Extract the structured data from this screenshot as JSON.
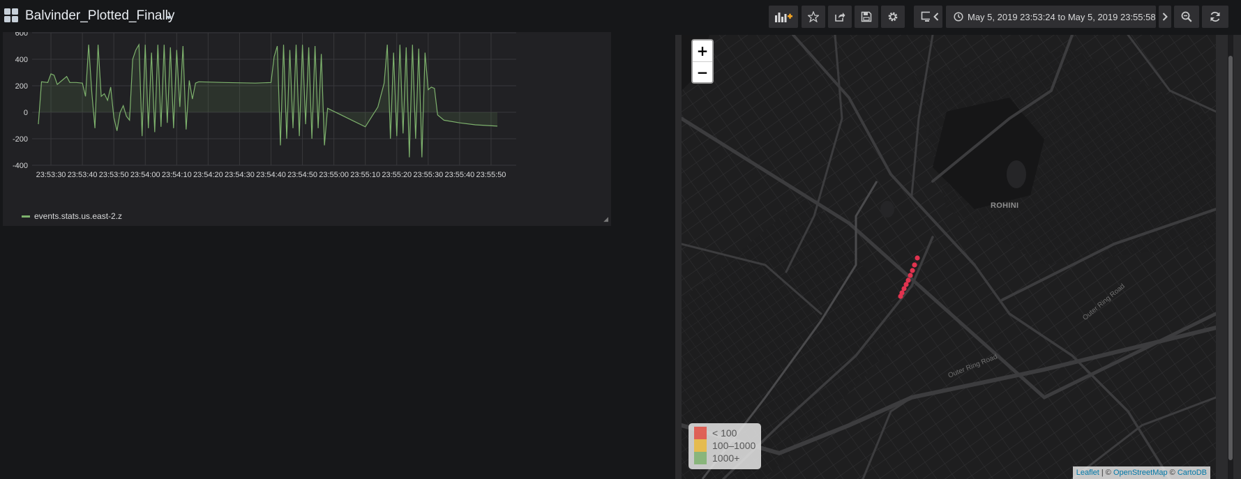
{
  "navbar": {
    "title": "Balvinder_Plotted_Finally",
    "buttons": [
      "add-panel-icon",
      "star-icon",
      "share-icon",
      "save-icon",
      "gear-icon",
      "monitor-icon"
    ],
    "time_range": "May 5, 2019 23:53:24 to May 5, 2019 23:55:58"
  },
  "graph": {
    "legend_label": "events.stats.us.east-2.z",
    "series_color": "#7eb26d",
    "y_ticks": [
      "600",
      "400",
      "200",
      "0",
      "-200",
      "-400"
    ],
    "x_ticks": [
      "23:53:30",
      "23:53:40",
      "23:53:50",
      "23:54:00",
      "23:54:10",
      "23:54:20",
      "23:54:30",
      "23:54:40",
      "23:54:50",
      "23:55:00",
      "23:55:10",
      "23:55:20",
      "23:55:30",
      "23:55:40",
      "23:55:50"
    ]
  },
  "chart_data": {
    "type": "area",
    "title": "",
    "xlabel": "",
    "ylabel": "",
    "ylim": [
      -400,
      600
    ],
    "grid": true,
    "legend": "bottom-left",
    "series": [
      {
        "name": "events.stats.us.east-2.z",
        "color": "#7eb26d",
        "x_seconds_offsets_note_hidden": null,
        "points": [
          [
            "23:53:26",
            -90
          ],
          [
            "23:53:27",
            230
          ],
          [
            "23:53:29",
            225
          ],
          [
            "23:53:30",
            290
          ],
          [
            "23:53:31",
            280
          ],
          [
            "23:53:32",
            210
          ],
          [
            "23:53:34",
            250
          ],
          [
            "23:53:35",
            270
          ],
          [
            "23:53:36",
            225
          ],
          [
            "23:53:38",
            225
          ],
          [
            "23:53:40",
            220
          ],
          [
            "23:53:41",
            120
          ],
          [
            "23:53:42",
            510
          ],
          [
            "23:53:43",
            150
          ],
          [
            "23:53:44",
            -120
          ],
          [
            "23:53:45",
            510
          ],
          [
            "23:53:46",
            120
          ],
          [
            "23:53:47",
            140
          ],
          [
            "23:53:48",
            90
          ],
          [
            "23:53:49",
            190
          ],
          [
            "23:53:50",
            -40
          ],
          [
            "23:53:51",
            -140
          ],
          [
            "23:53:52",
            0
          ],
          [
            "23:53:53",
            50
          ],
          [
            "23:53:54",
            -30
          ],
          [
            "23:53:55",
            -60
          ],
          [
            "23:53:56",
            400
          ],
          [
            "23:53:57",
            470
          ],
          [
            "23:53:58",
            510
          ],
          [
            "23:53:59",
            -180
          ],
          [
            "23:54:00",
            510
          ],
          [
            "23:54:01",
            -120
          ],
          [
            "23:54:02",
            450
          ],
          [
            "23:54:03",
            -150
          ],
          [
            "23:54:04",
            510
          ],
          [
            "23:54:05",
            -110
          ],
          [
            "23:54:06",
            510
          ],
          [
            "23:54:07",
            -80
          ],
          [
            "23:54:08",
            490
          ],
          [
            "23:54:09",
            -120
          ],
          [
            "23:54:10",
            470
          ],
          [
            "23:54:11",
            40
          ],
          [
            "23:54:12",
            500
          ],
          [
            "23:54:13",
            -130
          ],
          [
            "23:54:14",
            240
          ],
          [
            "23:54:15",
            100
          ],
          [
            "23:54:16",
            220
          ],
          [
            "23:54:17",
            230
          ],
          [
            "23:54:25",
            225
          ],
          [
            "23:54:35",
            220
          ],
          [
            "23:54:40",
            225
          ],
          [
            "23:54:41",
            420
          ],
          [
            "23:54:42",
            500
          ],
          [
            "23:54:43",
            -250
          ],
          [
            "23:54:44",
            510
          ],
          [
            "23:54:45",
            -200
          ],
          [
            "23:54:46",
            470
          ],
          [
            "23:54:47",
            -120
          ],
          [
            "23:54:48",
            510
          ],
          [
            "23:54:49",
            -180
          ],
          [
            "23:54:50",
            510
          ],
          [
            "23:54:51",
            -90
          ],
          [
            "23:54:52",
            490
          ],
          [
            "23:54:53",
            -200
          ],
          [
            "23:54:54",
            500
          ],
          [
            "23:54:55",
            -120
          ],
          [
            "23:54:56",
            440
          ],
          [
            "23:54:57",
            -250
          ],
          [
            "23:54:58",
            30
          ],
          [
            "23:55:10",
            -110
          ],
          [
            "23:55:14",
            40
          ],
          [
            "23:55:16",
            220
          ],
          [
            "23:55:17",
            510
          ],
          [
            "23:55:18",
            -200
          ],
          [
            "23:55:19",
            450
          ],
          [
            "23:55:20",
            -180
          ],
          [
            "23:55:21",
            510
          ],
          [
            "23:55:22",
            -160
          ],
          [
            "23:55:23",
            490
          ],
          [
            "23:55:24",
            -340
          ],
          [
            "23:55:25",
            510
          ],
          [
            "23:55:26",
            -200
          ],
          [
            "23:55:27",
            480
          ],
          [
            "23:55:28",
            -340
          ],
          [
            "23:55:29",
            450
          ],
          [
            "23:55:30",
            170
          ],
          [
            "23:55:31",
            190
          ],
          [
            "23:55:32",
            180
          ],
          [
            "23:55:33",
            -20
          ],
          [
            "23:55:35",
            -60
          ],
          [
            "23:55:40",
            -80
          ],
          [
            "23:55:45",
            -95
          ],
          [
            "23:55:52",
            -105
          ]
        ]
      }
    ]
  },
  "map": {
    "zoom_in": "+",
    "zoom_out": "−",
    "area_label": "ROHINI",
    "road_label_1": "Outer Ring Road",
    "road_label_2": "Outer Ring Road",
    "marker_color": "#e0334f",
    "legend": [
      {
        "label": "< 100",
        "color": "#e24d42"
      },
      {
        "label": "100–1000",
        "color": "#eab839"
      },
      {
        "label": "1000+",
        "color": "#7eb26d"
      }
    ],
    "attribution": {
      "leaflet": "Leaflet",
      "sep1": " | © ",
      "osm": "OpenStreetMap",
      "sep2": " © ",
      "carto": "CartoDB"
    }
  }
}
